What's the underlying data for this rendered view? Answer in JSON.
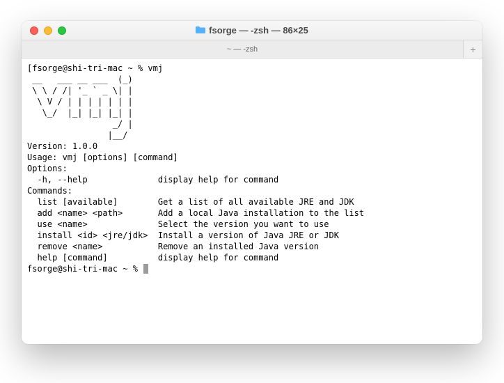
{
  "window": {
    "title": "fsorge — -zsh — 86×25"
  },
  "tabbar": {
    "active_tab_label": "~ — -zsh",
    "new_tab_glyph": "+"
  },
  "terminal": {
    "prompt_user_host": "fsorge@shi-tri-mac ~ %",
    "input_command": "vmj",
    "ascii_art": [
      " __   ___ __ ___  (_)",
      " \\ \\ / /| '_ ` _ \\| |",
      "  \\ V / | | | | | | |",
      "   \\_/  |_| |_| |_| |",
      "                 _/ |",
      "                |__/ "
    ],
    "version_line": "Version: 1.0.0",
    "usage_line": "Usage: vmj [options] [command]",
    "options_header": "Options:",
    "options": [
      {
        "flag": "  -h, --help",
        "desc": "display help for command"
      }
    ],
    "commands_header": "Commands:",
    "commands": [
      {
        "cmd": "  list [available]",
        "desc": "Get a list of all available JRE and JDK"
      },
      {
        "cmd": "  add <name> <path>",
        "desc": "Add a local Java installation to the list"
      },
      {
        "cmd": "  use <name>",
        "desc": "Select the version you want to use"
      },
      {
        "cmd": "  install <id> <jre/jdk>",
        "desc": "Install a version of Java JRE or JDK"
      },
      {
        "cmd": "  remove <name>",
        "desc": "Remove an installed Java version"
      },
      {
        "cmd": "  help [command]",
        "desc": "display help for command"
      }
    ],
    "prompt_user_host_2": "fsorge@shi-tri-mac ~ % "
  }
}
